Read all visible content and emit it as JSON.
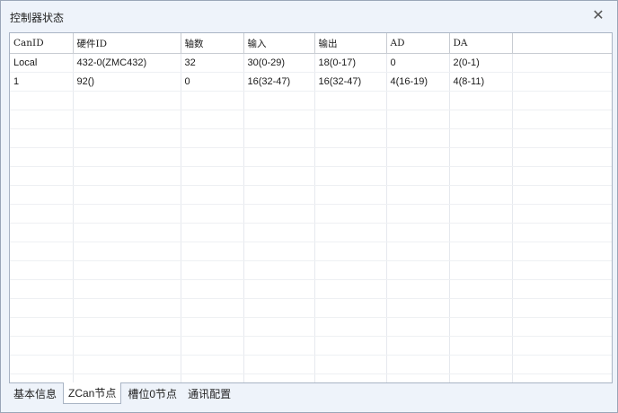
{
  "window": {
    "title": "控制器状态"
  },
  "table": {
    "columns": [
      "CanID",
      "硬件ID",
      "轴数",
      "输入",
      "输出",
      "AD",
      "DA",
      ""
    ],
    "rows": [
      [
        "Local",
        "432-0(ZMC432)",
        "32",
        "30(0-29)",
        "18(0-17)",
        "0",
        "2(0-1)",
        ""
      ],
      [
        "1",
        "92()",
        "0",
        "16(32-47)",
        "16(32-47)",
        "4(16-19)",
        "4(8-11)",
        ""
      ]
    ]
  },
  "tabs": [
    {
      "label": "基本信息",
      "active": false
    },
    {
      "label": "ZCan节点",
      "active": true
    },
    {
      "label": "槽位0节点",
      "active": false
    },
    {
      "label": "通讯配置",
      "active": false
    }
  ]
}
